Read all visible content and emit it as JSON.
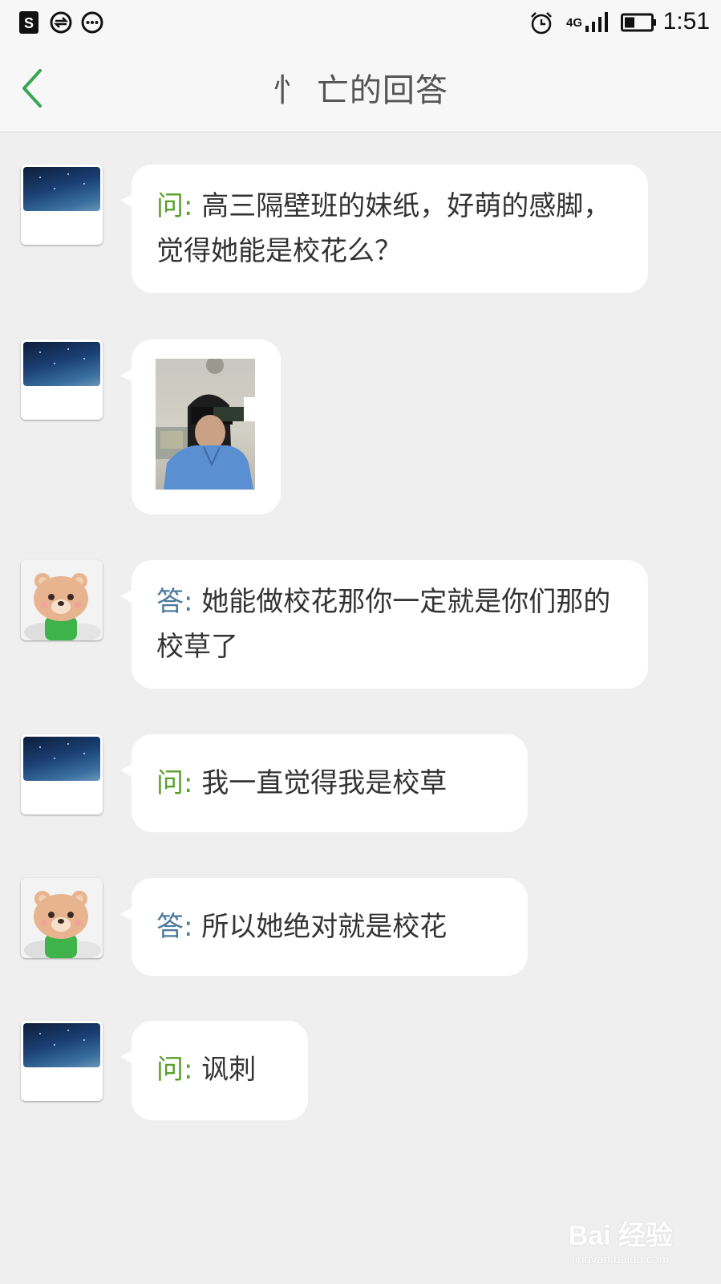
{
  "status_bar": {
    "time": "1:51",
    "network": "4G",
    "icons": [
      "music-app-icon",
      "sync-app-icon",
      "message-app-icon",
      "alarm-icon",
      "signal-icon",
      "battery-icon"
    ]
  },
  "header": {
    "title": "忄 亡的回答",
    "back_icon": "chevron-left-icon",
    "accent_color": "#3aa655"
  },
  "messages": [
    {
      "role": "question",
      "label": "问:",
      "text": "高三隔壁班的妹纸，好萌的感脚，觉得她能是校花么？",
      "avatar": "night-sky-avatar"
    },
    {
      "role": "question",
      "type": "image",
      "avatar": "night-sky-avatar"
    },
    {
      "role": "answer",
      "label": "答:",
      "text": "她能做校花那你一定就是你们那的校草了",
      "avatar": "bear-avatar"
    },
    {
      "role": "question",
      "label": "问:",
      "text": "我一直觉得我是校草",
      "avatar": "night-sky-avatar"
    },
    {
      "role": "answer",
      "label": "答:",
      "text": "所以她绝对就是校花",
      "avatar": "bear-avatar"
    },
    {
      "role": "question",
      "label": "问:",
      "text": "讽刺",
      "avatar": "night-sky-avatar"
    }
  ],
  "colors": {
    "question_label": "#5aa02c",
    "answer_label": "#4b7a9e",
    "background": "#efefef",
    "bubble": "#ffffff"
  },
  "watermark": {
    "main": "Bai 经验",
    "sub": "jingyan.baidu.com"
  }
}
